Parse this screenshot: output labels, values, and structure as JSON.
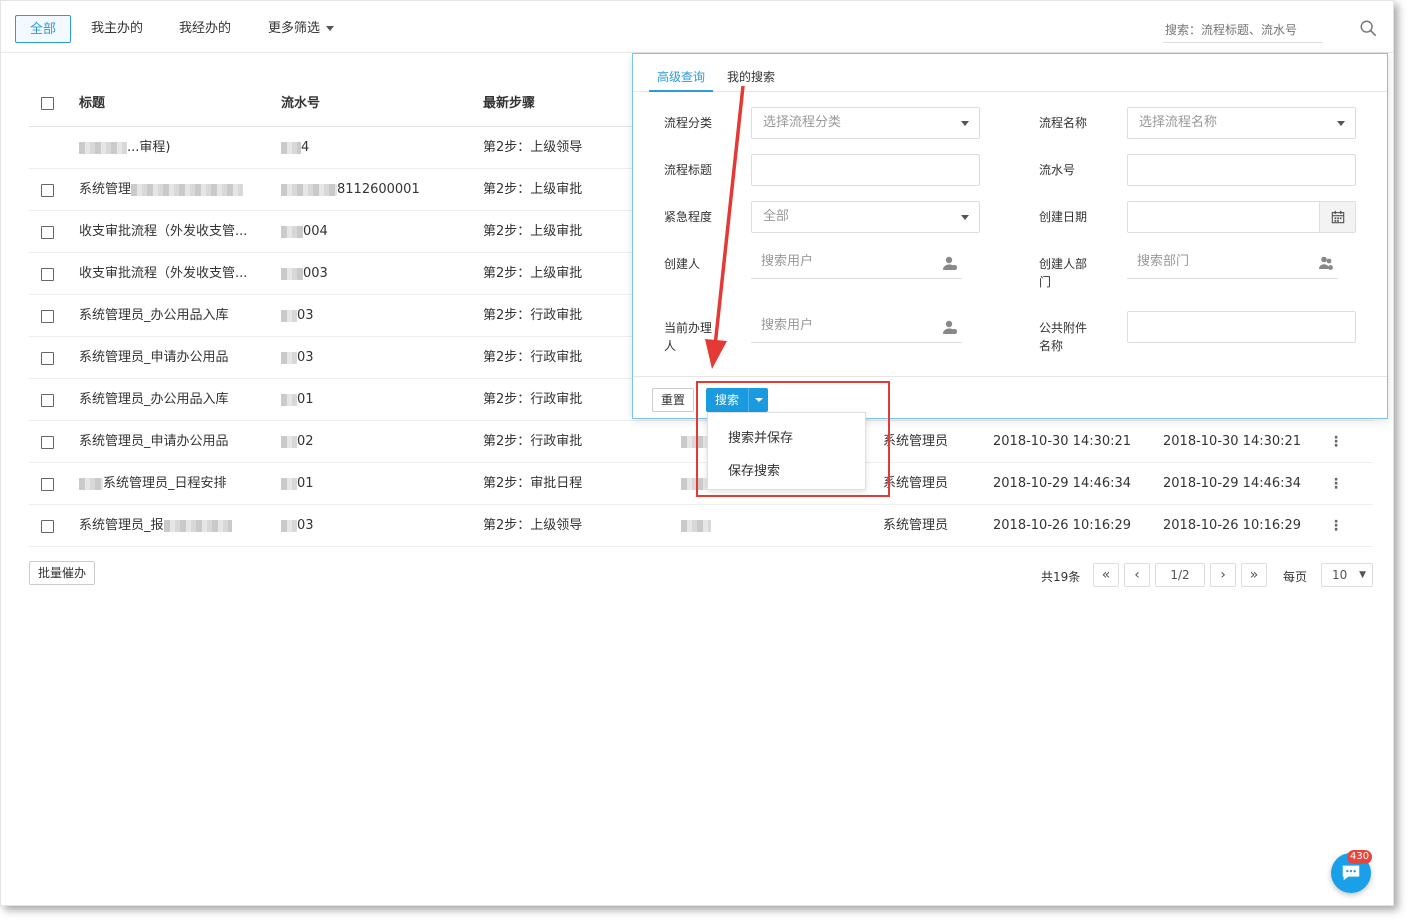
{
  "topbar": {
    "tabs": [
      {
        "label": "全部",
        "active": true
      },
      {
        "label": "我主办的",
        "active": false
      },
      {
        "label": "我经办的",
        "active": false
      },
      {
        "label": "更多筛选",
        "active": false
      }
    ],
    "search_placeholder": "搜索：流程标题、流水号"
  },
  "table": {
    "columns": [
      "标题",
      "流水号",
      "最新步骤"
    ],
    "rows": [
      {
        "title_prefix": "",
        "title": "...审程)",
        "serial": "4",
        "step": "第2步：上级领导",
        "creator": "",
        "created": "",
        "updated": "",
        "has_checkbox": false
      },
      {
        "title_prefix": "",
        "title": "系统管理",
        "serial": "8112600001",
        "step": "第2步：上级审批",
        "creator": "",
        "created": "",
        "updated": "",
        "has_checkbox": true
      },
      {
        "title_prefix": "",
        "title": "收支审批流程（外发收支管...",
        "serial": "004",
        "step": "第2步：上级审批",
        "creator": "",
        "created": "",
        "updated": "",
        "has_checkbox": true
      },
      {
        "title_prefix": "",
        "title": "收支审批流程（外发收支管...",
        "serial": "003",
        "step": "第2步：上级审批",
        "creator": "",
        "created": "",
        "updated": "",
        "has_checkbox": true
      },
      {
        "title_prefix": "",
        "title": "系统管理员_办公用品入库",
        "serial": "03",
        "step": "第2步：行政审批",
        "creator": "",
        "created": "",
        "updated": "",
        "has_checkbox": true
      },
      {
        "title_prefix": "",
        "title": "系统管理员_申请办公用品",
        "serial": "03",
        "step": "第2步：行政审批",
        "creator": "",
        "created": "",
        "updated": "",
        "has_checkbox": true
      },
      {
        "title_prefix": "",
        "title": "系统管理员_办公用品入库",
        "serial": "01",
        "step": "第2步：行政审批",
        "creator": "",
        "created": "",
        "updated": "",
        "has_checkbox": true
      },
      {
        "title_prefix": "",
        "title": "系统管理员_申请办公用品",
        "serial": "02",
        "step": "第2步：行政审批",
        "creator": "系统管理员",
        "created": "2018-10-30 14:30:21",
        "updated": "2018-10-30 14:30:21",
        "has_checkbox": true
      },
      {
        "title_prefix": "",
        "title": "系统管理员_日程安排",
        "serial": "01",
        "step": "第2步：审批日程",
        "creator": "系统管理员",
        "created": "2018-10-29 14:46:34",
        "updated": "2018-10-29 14:46:34",
        "has_checkbox": true
      },
      {
        "title_prefix": "",
        "title": "系统管理员_报",
        "serial": "03",
        "step": "第2步：上级领导",
        "creator": "系统管理员",
        "created": "2018-10-26 10:16:29",
        "updated": "2018-10-26 10:16:29",
        "has_checkbox": true
      }
    ]
  },
  "footer": {
    "batch_button": "批量催办",
    "total": "共19条",
    "page": "1/2",
    "per_page_label": "每页",
    "per_page": "10"
  },
  "panel": {
    "tabs": [
      "高级查询",
      "我的搜索"
    ],
    "fields": {
      "category_label": "流程分类",
      "category_placeholder": "选择流程分类",
      "name_label": "流程名称",
      "name_placeholder": "选择流程名称",
      "title_label": "流程标题",
      "serial_label": "流水号",
      "urgency_label": "紧急程度",
      "urgency_value": "全部",
      "date_label": "创建日期",
      "creator_label": "创建人",
      "creator_placeholder": "搜索用户",
      "dept_label": "创建人部门",
      "dept_placeholder": "搜索部门",
      "handler_label": "当前办理人",
      "handler_placeholder": "搜索用户",
      "attachment_label": "公共附件名称"
    },
    "reset_button": "重置",
    "search_button": "搜索",
    "dropdown_items": [
      "搜索并保存",
      "保存搜索"
    ]
  },
  "chat": {
    "badge": "430"
  },
  "colors": {
    "accent": "#2b9bda",
    "primary_button": "#1a9ae0",
    "highlight": "#e53935"
  }
}
